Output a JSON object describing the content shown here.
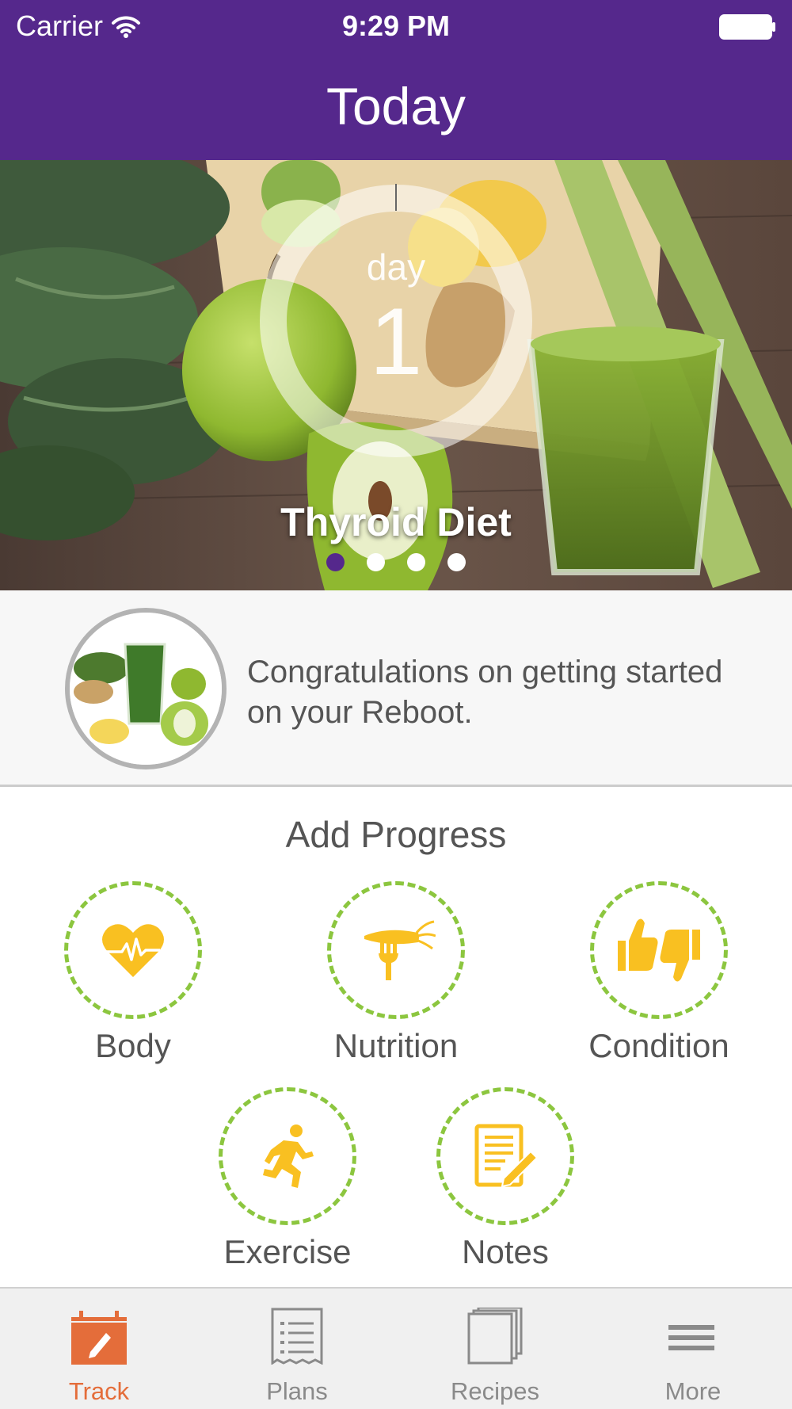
{
  "status_bar": {
    "carrier": "Carrier",
    "time": "9:29 PM"
  },
  "nav": {
    "title": "Today"
  },
  "hero": {
    "day_word": "day",
    "day_number": "1",
    "plan_name": "Thyroid Diet",
    "page_count": 4,
    "active_page": 1
  },
  "message": {
    "text": "Congratulations on getting started on your Reboot."
  },
  "add_progress": {
    "title": "Add Progress",
    "items": [
      {
        "label": "Body",
        "icon": "heart-pulse-icon"
      },
      {
        "label": "Nutrition",
        "icon": "carrot-fork-icon"
      },
      {
        "label": "Condition",
        "icon": "thumbs-up-down-icon"
      },
      {
        "label": "Exercise",
        "icon": "running-person-icon"
      },
      {
        "label": "Notes",
        "icon": "notes-pencil-icon"
      }
    ]
  },
  "tab_bar": {
    "items": [
      {
        "label": "Track",
        "icon": "calendar-pencil-icon",
        "active": true
      },
      {
        "label": "Plans",
        "icon": "list-document-icon",
        "active": false
      },
      {
        "label": "Recipes",
        "icon": "recipe-book-icon",
        "active": false
      },
      {
        "label": "More",
        "icon": "hamburger-menu-icon",
        "active": false
      }
    ]
  },
  "colors": {
    "brand_purple": "#55288c",
    "accent_yellow": "#f9c021",
    "dashed_green": "#8cc63f",
    "active_tab_orange": "#e46d3a"
  }
}
